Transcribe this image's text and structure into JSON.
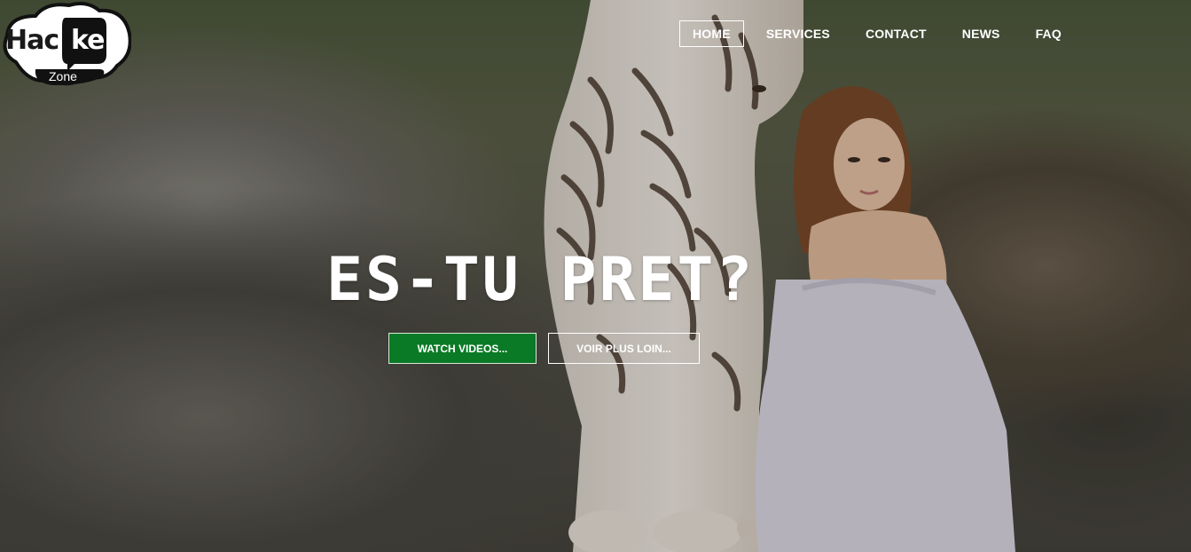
{
  "logo": {
    "main_left": "Hac",
    "main_right": "ker",
    "sub": "Zone"
  },
  "nav": {
    "items": [
      {
        "label": "HOME",
        "active": true
      },
      {
        "label": "SERVICES",
        "active": false
      },
      {
        "label": "CONTACT",
        "active": false
      },
      {
        "label": "NEWS",
        "active": false
      },
      {
        "label": "FAQ",
        "active": false
      }
    ]
  },
  "hero": {
    "headline": "ES-TU PRET?",
    "primary_button": "WATCH VIDEOS...",
    "secondary_button": "VOIR PLUS LOIN..."
  },
  "colors": {
    "primary_button_bg": "#0a7a26",
    "text": "#ffffff"
  }
}
